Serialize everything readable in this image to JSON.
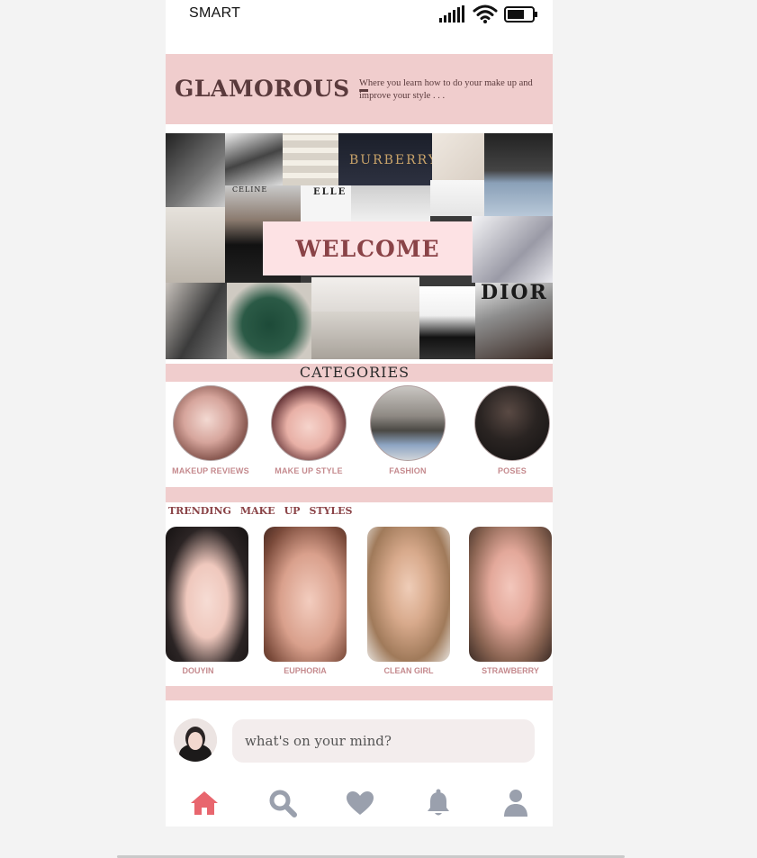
{
  "status_bar": {
    "carrier": "SMART"
  },
  "header": {
    "brand": "GLAMOROUS –",
    "tagline": "Where you learn how to do your make up and improve your style . . ."
  },
  "banner": {
    "welcome": "WELCOME",
    "brand_prints": [
      "BURBERRY",
      "CÉLINE",
      "DIOR",
      "ELLE"
    ]
  },
  "categories": {
    "title": "CATEGORIES",
    "items": [
      {
        "label": "MAKEUP REVIEWS"
      },
      {
        "label": "MAKE UP STYLE"
      },
      {
        "label": "FASHION"
      },
      {
        "label": "POSES"
      }
    ]
  },
  "trending": {
    "heading": [
      "TRENDING",
      "MAKE",
      "UP",
      "STYLES"
    ],
    "items": [
      {
        "label": "DOUYIN"
      },
      {
        "label": "EUPHORIA"
      },
      {
        "label": "CLEAN GIRL"
      },
      {
        "label": "STRAWBERRY"
      }
    ]
  },
  "composer": {
    "placeholder": "what's on your mind?"
  },
  "nav": {
    "items": [
      {
        "icon": "home-icon",
        "active": true
      },
      {
        "icon": "search-icon",
        "active": false
      },
      {
        "icon": "heart-icon",
        "active": false
      },
      {
        "icon": "bell-icon",
        "active": false
      },
      {
        "icon": "profile-icon",
        "active": false
      }
    ]
  },
  "colors": {
    "accent_pink": "#f0cdcd",
    "nav_active": "#e8666e",
    "nav_inactive": "#9aa0ad",
    "label_pink": "#c58a8e",
    "title_maroon": "#8a4347"
  }
}
